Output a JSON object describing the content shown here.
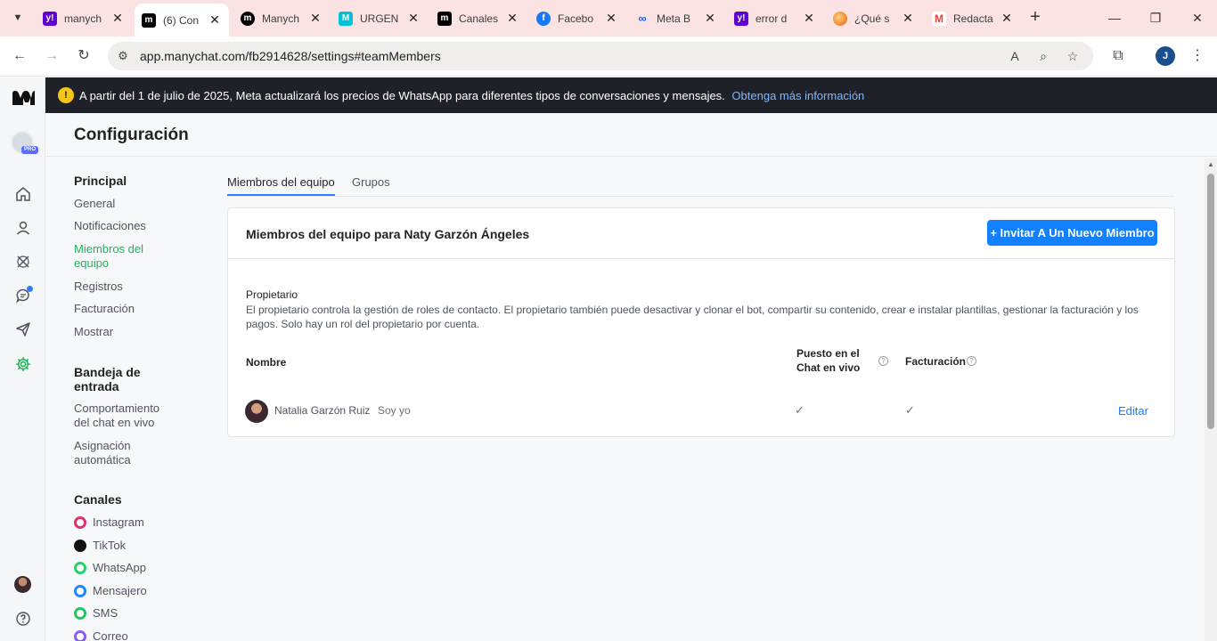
{
  "browser": {
    "tabs": [
      {
        "title": "manych",
        "favicon": "yahoo-icon",
        "color": "#6001d2"
      },
      {
        "title": "(6) Con",
        "favicon": "manychat-icon",
        "color": "#000000",
        "active": true
      },
      {
        "title": "Manych",
        "favicon": "manychat-icon",
        "color": "#000000"
      },
      {
        "title": "URGEN",
        "favicon": "manychat-icon",
        "color": "#00c2d6"
      },
      {
        "title": "Canales",
        "favicon": "manychat-icon",
        "color": "#000000"
      },
      {
        "title": "Facebo",
        "favicon": "facebook-icon",
        "color": "#1877f2"
      },
      {
        "title": "Meta B",
        "favicon": "meta-icon",
        "color": "#0a66ff"
      },
      {
        "title": "error d",
        "favicon": "yahoo-icon",
        "color": "#6001d2"
      },
      {
        "title": "¿Qué s",
        "favicon": "ai-orb-icon",
        "color": "#f28c38"
      },
      {
        "title": "Redacta",
        "favicon": "gmail-icon",
        "color": "#ea4335"
      }
    ],
    "url": "app.manychat.com/fb2914628/settings#teamMembers",
    "profile_initial": "J"
  },
  "banner": {
    "text": "A partir del 1 de julio de 2025, Meta actualizará los precios de WhatsApp para diferentes tipos de conversaciones y mensajes.",
    "link": "Obtenga más información"
  },
  "rail": {
    "pro_label": "PRO"
  },
  "page": {
    "title": "Configuración"
  },
  "settings_nav": {
    "principal": {
      "heading": "Principal",
      "items": [
        "General",
        "Notificaciones",
        "Miembros del equipo",
        "Registros",
        "Facturación",
        "Mostrar"
      ]
    },
    "inbox": {
      "heading": "Bandeja de entrada",
      "items": [
        "Comportamiento del chat en vivo",
        "Asignación automática"
      ]
    },
    "channels": {
      "heading": "Canales",
      "items": [
        {
          "label": "Instagram",
          "color": "#e1306c"
        },
        {
          "label": "TikTok",
          "color": "#111111"
        },
        {
          "label": "WhatsApp",
          "color": "#25d366"
        },
        {
          "label": "Mensajero",
          "color": "#1e88ff"
        },
        {
          "label": "SMS",
          "color": "#22c55e"
        },
        {
          "label": "Correo",
          "color": "#8b5cf6"
        }
      ]
    }
  },
  "tabs": [
    "Miembros del equipo",
    "Grupos"
  ],
  "card": {
    "title": "Miembros del equipo para Naty Garzón Ángeles",
    "invite_label": "+ Invitar A Un Nuevo Miembro",
    "role_name": "Propietario",
    "role_description": "El propietario controla la gestión de roles de contacto. El propietario también puede desactivar y clonar el bot, compartir su contenido, crear e instalar plantillas, gestionar la facturación y los pagos. Solo hay un rol del propietario por cuenta.",
    "columns": {
      "name": "Nombre",
      "live_chat": "Puesto en el Chat en vivo",
      "billing": "Facturación"
    },
    "member": {
      "name": "Natalia Garzón Ruiz",
      "self_label": "Soy yo",
      "live_chat": "✓",
      "billing": "✓",
      "edit_label": "Editar"
    }
  }
}
